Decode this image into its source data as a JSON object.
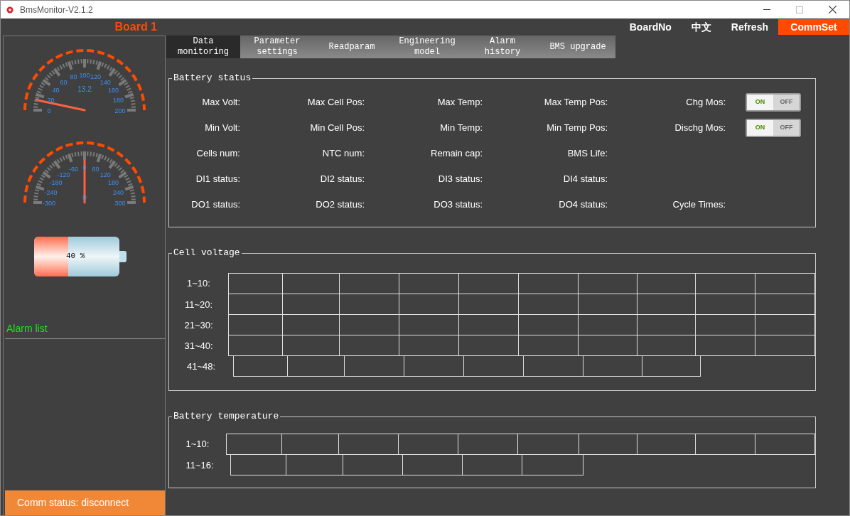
{
  "window": {
    "title": "BmsMonitor-V2.1.2"
  },
  "board": {
    "title": "Board 1"
  },
  "header_buttons": [
    {
      "label": "BoardNo",
      "selected": false
    },
    {
      "label": "中文",
      "selected": false
    },
    {
      "label": "Refresh",
      "selected": false
    },
    {
      "label": "CommSet",
      "selected": true
    }
  ],
  "tabs": [
    {
      "label": "Data monitoring",
      "selected": true
    },
    {
      "label": "Parameter settings",
      "selected": false
    },
    {
      "label": "Readparam",
      "selected": false
    },
    {
      "label": "Engineering model",
      "selected": false
    },
    {
      "label": "Alarm history",
      "selected": false
    },
    {
      "label": "BMS upgrade",
      "selected": false
    }
  ],
  "gauges": [
    {
      "ticks": [
        "0",
        "20",
        "40",
        "60",
        "80",
        "100",
        "120",
        "140",
        "160",
        "180",
        "200"
      ],
      "reading": "13.2"
    },
    {
      "ticks": [
        "-300",
        "-240",
        "-180",
        "-120",
        "-60",
        "0",
        "60",
        "120",
        "180",
        "240",
        "300"
      ],
      "reading": "0"
    }
  ],
  "battery": {
    "label": "40 %",
    "level": 0.4
  },
  "alarm_list": {
    "title": "Alarm list"
  },
  "status_bar": {
    "text": "Comm status: disconnect"
  },
  "battery_status": {
    "title": "Battery status",
    "rows": [
      [
        "Max Volt:",
        "Max Cell Pos:",
        "Max Temp:",
        "Max Temp Pos:",
        "Chg Mos:"
      ],
      [
        "Min Volt:",
        "Min Cell Pos:",
        "Min Temp:",
        "Min Temp Pos:",
        "Dischg Mos:"
      ],
      [
        "Cells num:",
        "NTC num:",
        "Remain cap:",
        "BMS Life:"
      ],
      [
        "DI1 status:",
        "DI2 status:",
        "DI3 status:",
        "DI4 status:"
      ],
      [
        "DO1 status:",
        "DO2 status:",
        "DO3 status:",
        "DO4 status:",
        "Cycle Times:"
      ]
    ],
    "switches": [
      {
        "on_label": "ON",
        "off_label": "OFF",
        "on": true
      },
      {
        "on_label": "ON",
        "off_label": "OFF",
        "on": true
      }
    ]
  },
  "cell_voltage": {
    "title": "Cell voltage",
    "rows": [
      {
        "label": "1~10:",
        "cells": [
          {
            "kind": "empty"
          },
          {
            "kind": "empty"
          },
          {
            "kind": "empty"
          },
          {
            "kind": "empty"
          },
          {
            "kind": "empty"
          },
          {
            "kind": "empty"
          },
          {
            "kind": "empty"
          },
          {
            "kind": "empty"
          },
          {
            "kind": "empty"
          },
          {
            "kind": "empty"
          }
        ]
      },
      {
        "label": "11~20:",
        "cells": [
          {
            "kind": "empty"
          },
          {
            "kind": "empty"
          },
          {
            "kind": "empty"
          },
          {
            "kind": "empty"
          },
          {
            "kind": "empty"
          },
          {
            "kind": "empty"
          },
          {
            "kind": "empty"
          },
          {
            "kind": "empty"
          },
          {
            "kind": "empty"
          },
          {
            "kind": "empty"
          }
        ]
      },
      {
        "label": "21~30:",
        "cells": [
          {
            "kind": "empty"
          },
          {
            "kind": "empty"
          },
          {
            "kind": "empty"
          },
          {
            "kind": "empty"
          },
          {
            "kind": "empty"
          },
          {
            "kind": "empty"
          },
          {
            "kind": "empty"
          },
          {
            "kind": "empty"
          },
          {
            "kind": "empty"
          },
          {
            "kind": "empty"
          }
        ]
      },
      {
        "label": "31~40:",
        "cells": [
          {
            "kind": "empty"
          },
          {
            "kind": "empty"
          },
          {
            "kind": "empty"
          },
          {
            "kind": "empty"
          },
          {
            "kind": "empty"
          },
          {
            "kind": "empty"
          },
          {
            "kind": "empty"
          },
          {
            "kind": "empty"
          },
          {
            "kind": "empty"
          },
          {
            "kind": "empty"
          }
        ]
      },
      {
        "label": "41~48:",
        "cells": [
          {
            "kind": "empty"
          },
          {
            "kind": "empty"
          },
          {
            "kind": "empty"
          },
          {
            "kind": "empty"
          },
          {
            "kind": "empty"
          },
          {
            "kind": "empty"
          },
          {
            "kind": "empty"
          },
          {
            "kind": "empty"
          }
        ]
      }
    ]
  },
  "battery_temperature": {
    "title": "Battery temperature",
    "rows": [
      {
        "label": "1~10:",
        "cells": [
          {
            "kind": "empty"
          },
          {
            "kind": "empty"
          },
          {
            "kind": "empty"
          },
          {
            "kind": "empty"
          },
          {
            "kind": "empty"
          },
          {
            "kind": "empty"
          },
          {
            "kind": "empty"
          },
          {
            "kind": "empty"
          },
          {
            "kind": "empty"
          },
          {
            "kind": "empty"
          }
        ]
      },
      {
        "label": "11~16:",
        "cells": [
          {
            "kind": "empty"
          },
          {
            "kind": "empty"
          },
          {
            "kind": "empty"
          },
          {
            "kind": "empty"
          },
          {
            "kind": "empty"
          },
          {
            "kind": "empty"
          }
        ]
      }
    ]
  }
}
